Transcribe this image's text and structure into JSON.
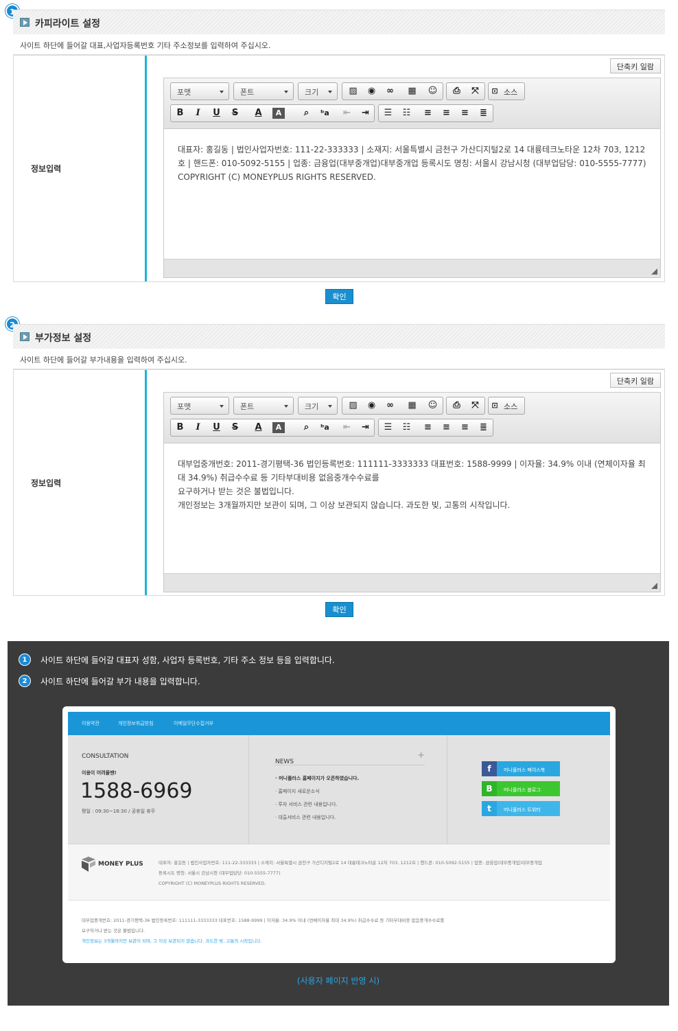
{
  "sections": [
    {
      "num": "1",
      "title": "카피라이트 설정",
      "desc": "사이트 하단에 들어갈 대표,사업자등록번호 기타 주소정보를 입력하여 주십시오.",
      "label": "정보입력",
      "shortcut": "단축키 일람",
      "content": [
        "대표자: 홍길동 | 법인사업자번호: 111-22-333333 | 소재지: 서울특별시 금천구 가산디지털2로 14 대륭테크노타운 12차 703, 1212호 | 핸드폰: 010-5092-5155 | 업종: 금융업(대부중개업)대부중개업 등록시도 명칭: 서울시 강남시청 (대부업담당: 010-5555-7777)",
        "COPYRIGHT (C) MONEYPLUS RIGHTS RESERVED."
      ],
      "confirm": "확인"
    },
    {
      "num": "2",
      "title": "부가정보 설정",
      "desc": "사이트 하단에 들어갈 부가내용을 입력하여 주십시오.",
      "label": "정보입력",
      "shortcut": "단축키 일람",
      "content": [
        "대부업중개번호: 2011-경기평택-36 법인등록번호: 111111-3333333 대표번호: 1588-9999 | 이자율: 34.9% 이내 (연체이자율 최대 34.9%) 취급수수료 등 기타부대비용 없음중개수수료를",
        "요구하거나 받는 것은 불법입니다.",
        "개인정보는 3개월까지만 보관이 되며, 그 이상 보관되지 않습니다. 과도한 빚, 고통의 시작입니다."
      ],
      "confirm": "확인"
    }
  ],
  "toolbar": {
    "format": "포맷",
    "font": "폰트",
    "size": "크기",
    "source": "소스",
    "bold": "B",
    "italic": "I",
    "underline": "U",
    "strike": "S",
    "fontcolor": "A",
    "bgcolor": "A"
  },
  "notes": [
    "사이트 하단에 들어갈 대표자 성함, 사업자 등록번호, 기타 주소 정보 등을 입력합니다.",
    "사이트 하단에 들어갈 부가 내용을 입력합니다."
  ],
  "preview": {
    "nav": [
      "이용약관",
      "개인정보취급방침",
      "이메일무단수집거부"
    ],
    "consult_title": "CONSULTATION",
    "consult_sub": "이용이 어려울땐!",
    "phone": "1588-6969",
    "hours": "평일 : 09:30~18:30 / 공휴일 휴무",
    "news_title": "NEWS",
    "news_plus": "+",
    "news": [
      "머니플러스 홈페이지가 오픈하였습니다.",
      "홈페이지 새로운소식",
      "투자 서비스 관련 내용입니다.",
      "대출서비스 관련 내용입니다."
    ],
    "sns": [
      {
        "icon": "f",
        "label": "머니플러스 페이스북",
        "color": "#3b5998"
      },
      {
        "icon": "B",
        "label": "머니플러스 블로그",
        "color": "#2fb52a"
      },
      {
        "icon": "t",
        "label": "머니플러스 트위터",
        "color": "#2aa7e0"
      }
    ],
    "logo": "MONEY PLUS",
    "foot_lines": [
      "대표자: 홍길동 | 법인사업자번호: 111-22-333333 | 소재지: 서울특별시 금천구 가산디지털2로 14 대륭테크노타운 12차 703, 1212호 | 핸드폰: 010-5092-5155 | 업종: 금융업(대부중개업)대부중개업",
      "등록시도 명칭: 서울시 강남시청 (대부업담당: 010-5555-7777)",
      "COPYRIGHT (C) MONEYPLUS RIGHTS RESERVED."
    ],
    "foot2_lines": [
      "대부업중개번호: 2011-경기평택-36 법인등록번호: 111111-3333333 대표번호: 1588-9999 | 이자율: 34.9% 이내 (연체이자율 최대 34.9%) 취급수수료 등 기타부대비용 없음중개수수료를",
      "요구하거나 받는 것은 불법입니다.",
      "개인정보는 3개월까지만 보관이 되며, 그 이상 보관되지 않습니다. 과도한 빚, 고통의 시작입니다."
    ]
  },
  "caption": "(사용자 페이지 반영 시)"
}
